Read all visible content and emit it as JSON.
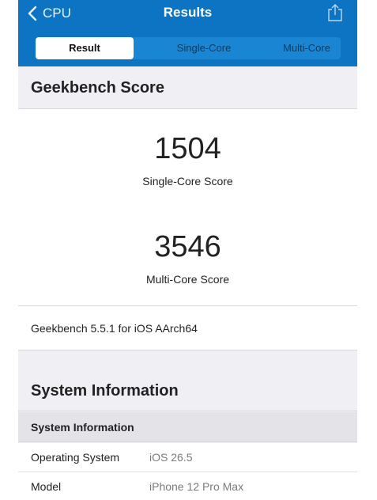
{
  "navbar": {
    "back_label": "CPU",
    "title": "Results"
  },
  "tabs": [
    {
      "label": "Result",
      "selected": true
    },
    {
      "label": "Single-Core",
      "selected": false
    },
    {
      "label": "Multi-Core",
      "selected": false
    }
  ],
  "geekbench_section": {
    "header": "Geekbench Score",
    "single_core_score": "1504",
    "single_core_label": "Single-Core Score",
    "multi_core_score": "3546",
    "multi_core_label": "Multi-Core Score",
    "version": "Geekbench 5.5.1 for iOS AArch64"
  },
  "system_section": {
    "header": "System Information",
    "table_header": "System Information",
    "rows": [
      {
        "key": "Operating System",
        "value": "iOS 26.5"
      },
      {
        "key": "Model",
        "value": "iPhone 12 Pro Max"
      }
    ]
  },
  "colors": {
    "accent": "#0c74c2",
    "background": "#efeff4"
  },
  "icons": {
    "back": "chevron-left-icon",
    "share": "share-icon"
  }
}
